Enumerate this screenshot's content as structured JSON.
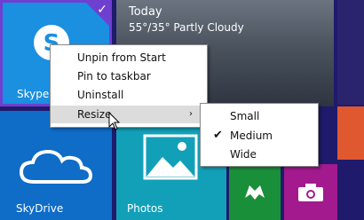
{
  "tiles": {
    "skype": {
      "label": "Skype",
      "check": "✓"
    },
    "weather": {
      "day": "Today",
      "forecast": "55°/35° Partly Cloudy"
    },
    "skydrive": {
      "label": "SkyDrive"
    },
    "photos": {
      "label": "Photos"
    }
  },
  "context_menu": {
    "items": [
      {
        "label": "Unpin from Start"
      },
      {
        "label": "Pin to taskbar"
      },
      {
        "label": "Uninstall"
      },
      {
        "label": "Resize",
        "submenu_arrow": "›"
      }
    ]
  },
  "resize_submenu": {
    "items": [
      {
        "label": "Small",
        "selected": false
      },
      {
        "label": "Medium",
        "selected": true,
        "check": "✔"
      },
      {
        "label": "Wide",
        "selected": false
      }
    ]
  },
  "colors": {
    "background": "#1f1a6b",
    "skype_tile": "#1b8fe0",
    "selection_border": "#6f3fd0",
    "skydrive_tile": "#0f6cc7",
    "photos_tile": "#12a0b8",
    "games_tile": "#1a8f3a",
    "camera_tile": "#a21a8e",
    "orange_tile": "#e0582f"
  }
}
